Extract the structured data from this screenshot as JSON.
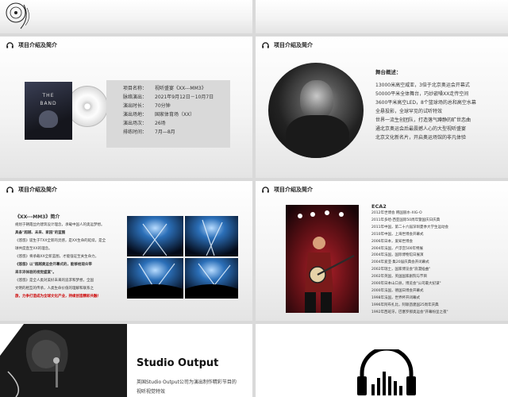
{
  "header_title": "项目介绍及简介",
  "slide2": {
    "album": {
      "line1": "THE",
      "line2": "BAND"
    },
    "info": [
      {
        "k": "项目名称：",
        "v": "视听盛宴《XX---MM3》"
      },
      {
        "k": "脉络演出：",
        "v": "2021年9月12日－10月7日"
      },
      {
        "k": "演出时长：",
        "v": "70分钟"
      },
      {
        "k": "演出场地：",
        "v": "国家体育场（XX）"
      },
      {
        "k": "演出场次：",
        "v": "26场"
      },
      {
        "k": "排练时间：",
        "v": "7月—8月"
      }
    ]
  },
  "slide3": {
    "title": "舞台概述：",
    "lines": [
      "13000米高空威亚，3倍于北京奥运会开幕式",
      "50000平米全体舞台，巧妙嵌嗓XX走传空间",
      "3600平米高空LED，8个篮球场的总和高空水幕",
      "全悬投影，全球罕见的试听特效",
      "世界一流生创团队，打造落气蹲静的旷世恋曲",
      "通北京奥运会后最震撼人心的大型视听盛宴",
      "北京文化新名片，开启奥运场馆的非凡体验"
    ]
  },
  "slide4": {
    "title": "《XX---MM3》简介",
    "lines": [
      "规划于朝霞丝约建筑设计理念，承载中国人的奥运梦想。",
      "具备\"超越、未来、家园\"的蓝图",
      "《悠悠》诞生于TXX全新的灵感，是XX生命的延续，是全",
      "球共度直至XX的理念。",
      "《悠悠》将承载XX全新蓝图，才能强证至关生命力。",
      "《悠悠》以\"超越奥运会开幕式的，能够给观众带",
      "来丰沛体验的视觉盛宴\"。",
      "《悠悠》是全人类对美好未来的追求和梦想，全国",
      "文明的相互的传承，人类生命价值的理解和联系之",
      "旅，力争打造成为全球文化产业，持续创造精彩共融！"
    ]
  },
  "slide5": {
    "title": "ECA2",
    "lines": [
      "2012年世博会 韩国丽水-XIG-O",
      "2011年多哈·西亚国际50周年暨国庆日庆典",
      "2011年中国，第二十六届深圳夏季大学生运动会",
      "2010年中国，上海世博会开幕式",
      "2006年日本，爱知世博会",
      "2004年法国，卢浮宫500年特展",
      "2004年法国，国际博物馆日展演",
      "2004年爱亚·集20届庆典会开闭幕式",
      "2002年瑞士，国家博览会\"浪漫插曲\"",
      "2002年英国，英国国家剧院与节目",
      "2000年日本山口县，博览会\"公司最大纪谋\"",
      "2000年法国，德国日博会开幕式",
      "1998年法国，世界杯开闭幕式",
      "1996年阿布扎比，阿联酋建国25周年庆典",
      "1992年西班牙，巴塞罗那奥运会\"开幕纷呈之夜\""
    ]
  },
  "slide6": {
    "title": "Studio Output",
    "lines": [
      "英国Studio Output公司为演出制作精彩节目的",
      "视听视觉特效"
    ]
  },
  "colors": {
    "accent": "#ff6600",
    "dark": "#222222"
  }
}
